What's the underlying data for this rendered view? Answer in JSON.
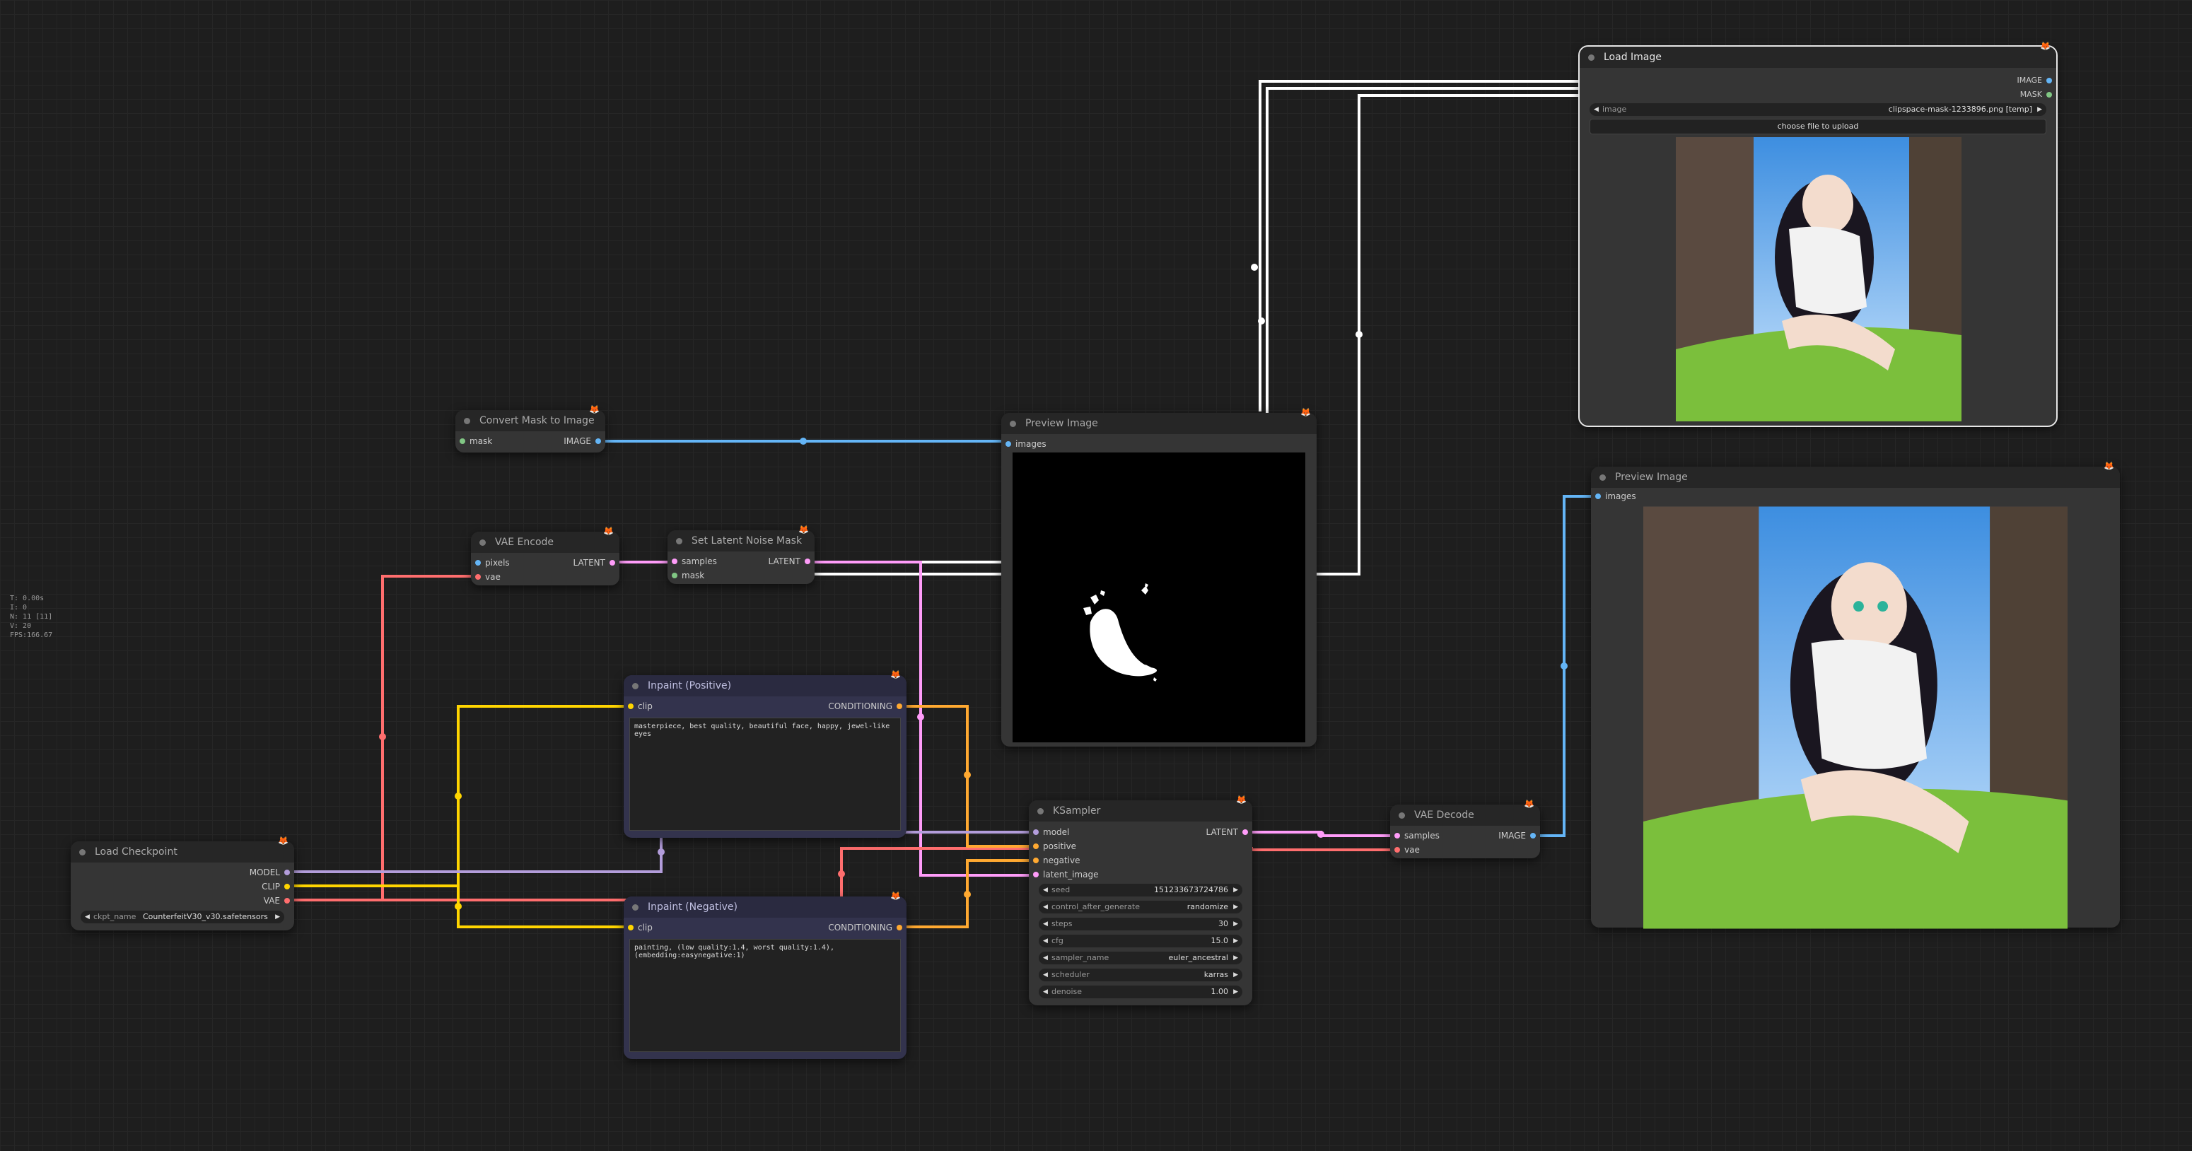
{
  "stats": {
    "t": "T: 0.00s",
    "i": "I: 0",
    "n": "N: 11 [11]",
    "v": "V: 20",
    "fps": "FPS:166.67"
  },
  "colors": {
    "model": "#b39ddb",
    "clip": "#ffd500",
    "vae": "#ff6e6e",
    "latent": "#ff9cf9",
    "image": "#64b5f6",
    "mask": "#81c784",
    "conditioning": "#ffa931",
    "white": "#ffffff"
  },
  "badge_icon": "fox-icon",
  "load_checkpoint": {
    "title": "Load Checkpoint",
    "out_model": "MODEL",
    "out_clip": "CLIP",
    "out_vae": "VAE",
    "widget_label": "ckpt_name",
    "widget_value": "CounterfeitV30_v30.safetensors"
  },
  "convert_mask": {
    "title": "Convert Mask to Image",
    "in_mask": "mask",
    "out_image": "IMAGE"
  },
  "vae_encode": {
    "title": "VAE Encode",
    "in_pixels": "pixels",
    "in_vae": "vae",
    "out_latent": "LATENT"
  },
  "set_latent": {
    "title": "Set Latent Noise Mask",
    "in_samples": "samples",
    "in_mask": "mask",
    "out_latent": "LATENT"
  },
  "inpaint_pos": {
    "title": "Inpaint (Positive)",
    "in_clip": "clip",
    "out_cond": "CONDITIONING",
    "text": "masterpiece, best quality, beautiful face, happy, jewel-like eyes"
  },
  "inpaint_neg": {
    "title": "Inpaint (Negative)",
    "in_clip": "clip",
    "out_cond": "CONDITIONING",
    "text": "painting, (low quality:1.4, worst quality:1.4), (embedding:easynegative:1)"
  },
  "preview1": {
    "title": "Preview Image",
    "in_images": "images"
  },
  "preview2": {
    "title": "Preview Image",
    "in_images": "images"
  },
  "ksampler": {
    "title": "KSampler",
    "in_model": "model",
    "in_positive": "positive",
    "in_negative": "negative",
    "in_latent": "latent_image",
    "out_latent": "LATENT",
    "widgets": [
      {
        "label": "seed",
        "value": "151233673724786"
      },
      {
        "label": "control_after_generate",
        "value": "randomize"
      },
      {
        "label": "steps",
        "value": "30"
      },
      {
        "label": "cfg",
        "value": "15.0"
      },
      {
        "label": "sampler_name",
        "value": "euler_ancestral"
      },
      {
        "label": "scheduler",
        "value": "karras"
      },
      {
        "label": "denoise",
        "value": "1.00"
      }
    ]
  },
  "vae_decode": {
    "title": "VAE Decode",
    "in_samples": "samples",
    "in_vae": "vae",
    "out_image": "IMAGE"
  },
  "load_image": {
    "title": "Load Image",
    "out_image": "IMAGE",
    "out_mask": "MASK",
    "widget_label": "image",
    "widget_value": "clipspace-mask-1233896.png [temp]",
    "upload_label": "choose file to upload"
  }
}
